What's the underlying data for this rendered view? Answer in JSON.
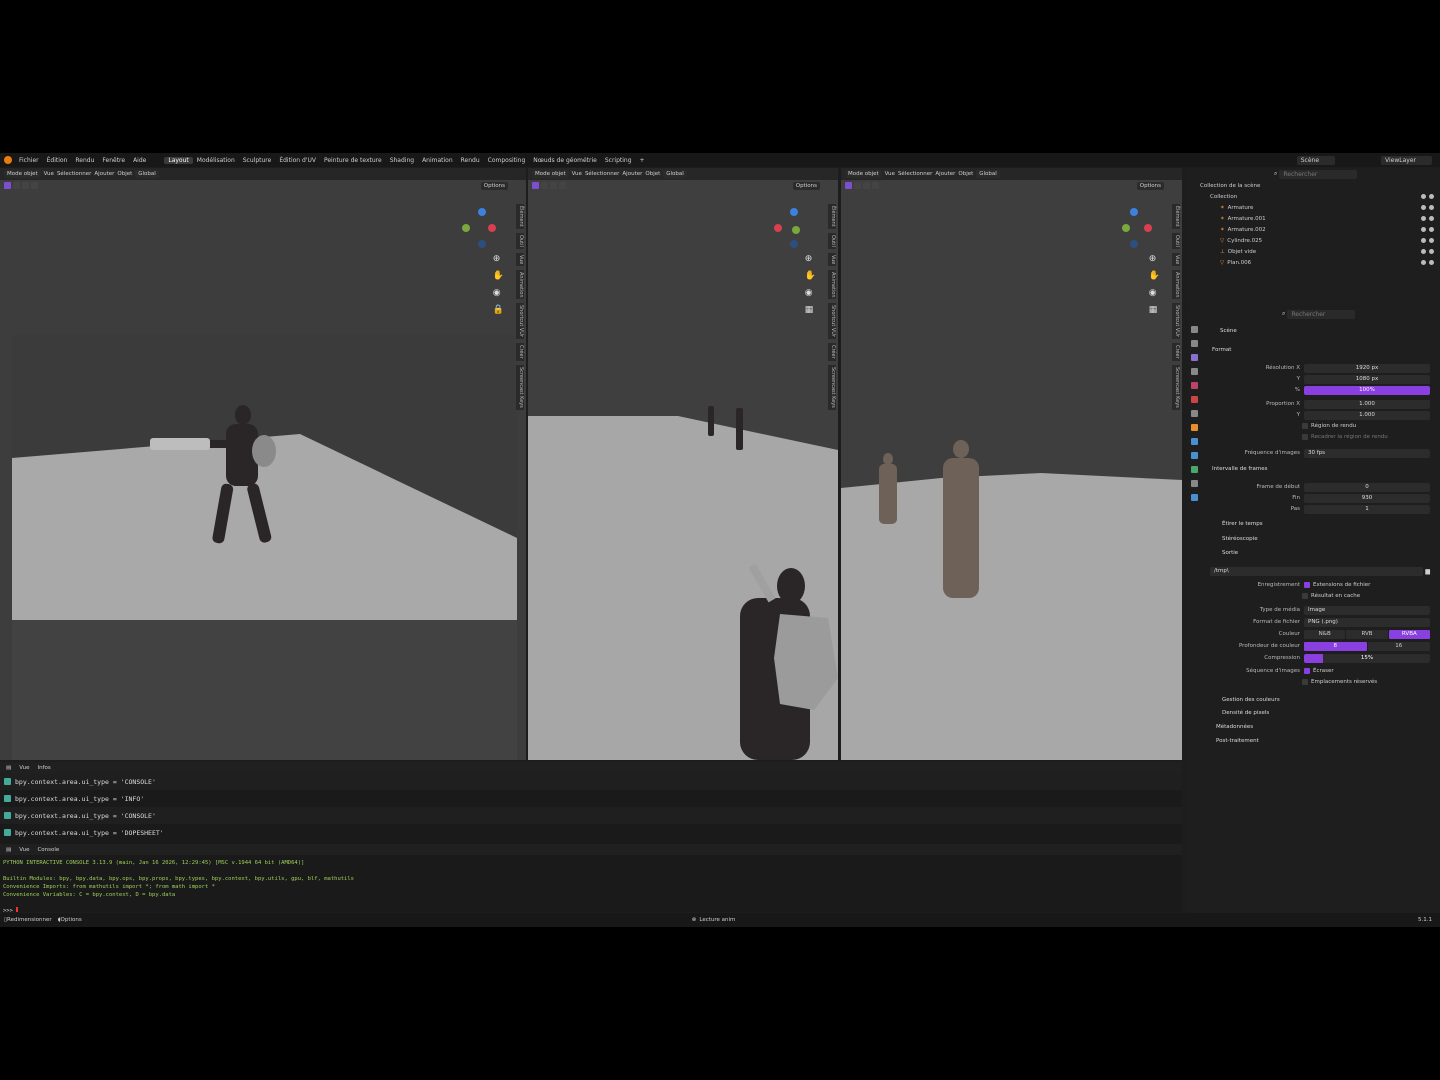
{
  "menu": {
    "items": [
      "Fichier",
      "Édition",
      "Rendu",
      "Fenêtre",
      "Aide"
    ],
    "workspaces": [
      "Layout",
      "Modélisation",
      "Sculpture",
      "Édition d'UV",
      "Peinture de texture",
      "Shading",
      "Animation",
      "Rendu",
      "Compositing",
      "Nœuds de géométrie",
      "Scripting"
    ],
    "add": "+",
    "active_workspace": "Layout",
    "scene": "Scène",
    "view_layer": "ViewLayer"
  },
  "viewports": [
    {
      "mode": "Mode objet",
      "menus": [
        "Vue",
        "Sélectionner",
        "Ajouter",
        "Objet"
      ],
      "orientation": "Global",
      "options": "Options"
    },
    {
      "mode": "Mode objet",
      "menus": [
        "Vue",
        "Sélectionner",
        "Ajouter",
        "Objet"
      ],
      "orientation": "Global",
      "options": "Options"
    },
    {
      "mode": "Mode objet",
      "menus": [
        "Vue",
        "Sélectionner",
        "Ajouter",
        "Objet"
      ],
      "orientation": "Global",
      "options": "Options"
    }
  ],
  "sidetabs": [
    "Élément",
    "Outil",
    "Vue",
    "Animation",
    "Shortcut VUr",
    "Créer",
    "Screencast Keys"
  ],
  "info_editor": {
    "menus": [
      "Vue",
      "Infos"
    ],
    "lines": [
      "bpy.context.area.ui_type = 'CONSOLE'",
      "bpy.context.area.ui_type = 'INFO'",
      "bpy.context.area.ui_type = 'CONSOLE'",
      "bpy.context.area.ui_type = 'DOPESHEET'"
    ]
  },
  "console": {
    "menus": [
      "Vue",
      "Console"
    ],
    "header_line": "PYTHON INTERACTIVE CONSOLE 3.13.9 (main, Jan 16 2026, 12:29:45) [MSC v.1944 64 bit (AMD64)]",
    "builtin": "Builtin Modules:       bpy, bpy.data, bpy.ops, bpy.props, bpy.types, bpy.context, bpy.utils, gpu, blf, mathutils",
    "imports": "Convenience Imports:   from mathutils import *; from math import *",
    "variables": "Convenience Variables: C = bpy.context, D = bpy.data",
    "prompt": ">>> "
  },
  "status": {
    "left": [
      "Redimensionner",
      "Options"
    ],
    "center": "Lecture anim",
    "version": "5.1.1"
  },
  "outliner": {
    "search_placeholder": "Rechercher",
    "root": "Collection de la scène",
    "collection": "Collection",
    "items": [
      "Armature",
      "Armature.001",
      "Armature.002",
      "Cylindre.025",
      "Objet vide",
      "Plan.006"
    ]
  },
  "properties": {
    "search_placeholder": "Rechercher",
    "breadcrumb": "Scène",
    "format_title": "Format",
    "res_x_label": "Résolution X",
    "res_x": "1920 px",
    "res_y_label": "Y",
    "res_y": "1080 px",
    "res_pct_label": "%",
    "res_pct": "100%",
    "aspect_x_label": "Proportion X",
    "aspect_x": "1.000",
    "aspect_y_label": "Y",
    "aspect_y": "1.000",
    "render_region": "Région de rendu",
    "crop_region": "Recadrer la région de rendu",
    "fps_label": "Fréquence d'images",
    "fps": "30 fps",
    "frame_range_title": "Intervalle de frames",
    "frame_start_label": "Frame de début",
    "frame_start": "0",
    "frame_end_label": "Fin",
    "frame_end": "930",
    "frame_step_label": "Pas",
    "frame_step": "1",
    "time_stretch": "Étirer le temps",
    "stereoscopy": "Stéréoscopie",
    "output_title": "Sortie",
    "output_path": "/tmp\\",
    "saving_label": "Enregistrement",
    "file_ext": "Extensions de fichier",
    "cache_result": "Résultat en cache",
    "media_type_label": "Type de média",
    "media_type": "Image",
    "file_format_label": "Format de fichier",
    "file_format": "PNG (.png)",
    "color_label": "Couleur",
    "color_modes": [
      "N&B",
      "RVB",
      "RVBA"
    ],
    "color_active": 2,
    "depth_label": "Profondeur de couleur",
    "depth_modes": [
      "8",
      "16"
    ],
    "compression_label": "Compression",
    "compression": "15%",
    "compression_value": 15,
    "sequence_label": "Séquence d'images",
    "overwrite": "Écraser",
    "placeholders": "Emplacements réservés",
    "color_management": "Gestion des couleurs",
    "pixel_density": "Densité de pixels",
    "metadata": "Métadonnées",
    "post_processing": "Post-traitement"
  }
}
